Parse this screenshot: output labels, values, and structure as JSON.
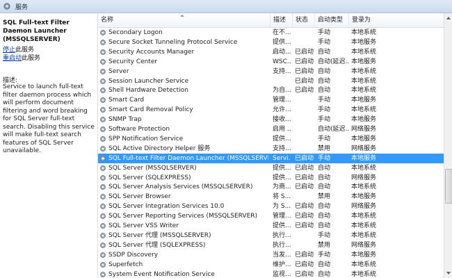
{
  "window": {
    "title": "服务"
  },
  "left": {
    "service_name": "SQL Full-text Filter Daemon Launcher (MSSQLSERVER)",
    "stop_link": "停止",
    "stop_suffix": "此服务",
    "restart_link": "重启动",
    "restart_suffix": "此服务",
    "desc_heading": "描述:",
    "description": "Service to launch full-text filter daemon process which will perform document filtering and word breaking for SQL Server full-text search. Disabling this service will make full-text search features of SQL Server unavailable."
  },
  "columns": [
    {
      "label": "名称"
    },
    {
      "label": "描述"
    },
    {
      "label": "状态"
    },
    {
      "label": "启动类型"
    },
    {
      "label": "登录为"
    }
  ],
  "rows": [
    {
      "name": "Secondary Logon",
      "desc": "在不...",
      "status": "",
      "start": "手动",
      "logon": "本地系统"
    },
    {
      "name": "Secure Socket Tunneling Protocol Service",
      "desc": "提供...",
      "status": "",
      "start": "手动",
      "logon": "本地服务"
    },
    {
      "name": "Security Accounts Manager",
      "desc": "启动...",
      "status": "已启动",
      "start": "自动",
      "logon": "本地系统"
    },
    {
      "name": "Security Center",
      "desc": "WSC...",
      "status": "已启动",
      "start": "自动(延迟...",
      "logon": "本地服务"
    },
    {
      "name": "Server",
      "desc": "支持...",
      "status": "已启动",
      "start": "自动",
      "logon": "本地系统"
    },
    {
      "name": "Session Launcher Service",
      "desc": "",
      "status": "已启动",
      "start": "自动",
      "logon": "本地系统"
    },
    {
      "name": "Shell Hardware Detection",
      "desc": "为自...",
      "status": "已启动",
      "start": "自动",
      "logon": "本地系统"
    },
    {
      "name": "Smart Card",
      "desc": "管理...",
      "status": "",
      "start": "手动",
      "logon": "本地服务"
    },
    {
      "name": "Smart Card Removal Policy",
      "desc": "允许...",
      "status": "",
      "start": "手动",
      "logon": "本地系统"
    },
    {
      "name": "SNMP Trap",
      "desc": "接收...",
      "status": "",
      "start": "手动",
      "logon": "本地服务"
    },
    {
      "name": "Software Protection",
      "desc": "启用 ...",
      "status": "",
      "start": "自动(延迟...",
      "logon": "网络服务"
    },
    {
      "name": "SPP Notification Service",
      "desc": "提供...",
      "status": "",
      "start": "手动",
      "logon": "本地服务"
    },
    {
      "name": "SQL Active Directory Helper 服务",
      "desc": "支持...",
      "status": "",
      "start": "禁用",
      "logon": "网络服务"
    },
    {
      "name": "SQL Full-text Filter Daemon Launcher (MSSQLSERVER)",
      "desc": "Servi...",
      "status": "已启动",
      "start": "手动",
      "logon": "本地服务",
      "selected": true
    },
    {
      "name": "SQL Server (MSSQLSERVER)",
      "desc": "提供...",
      "status": "已启动",
      "start": "自动",
      "logon": "本地系统"
    },
    {
      "name": "SQL Server (SQLEXPRESS)",
      "desc": "提供...",
      "status": "已启动",
      "start": "自动",
      "logon": "网络服务"
    },
    {
      "name": "SQL Server Analysis Services (MSSQLSERVER)",
      "desc": "为商...",
      "status": "已启动",
      "start": "自动",
      "logon": "本地系统"
    },
    {
      "name": "SQL Server Browser",
      "desc": "将 S...",
      "status": "",
      "start": "禁用",
      "logon": "本地服务"
    },
    {
      "name": "SQL Server Integration Services 10.0",
      "desc": "为 S...",
      "status": "已启动",
      "start": "自动",
      "logon": "网络服务"
    },
    {
      "name": "SQL Server Reporting Services (MSSQLSERVER)",
      "desc": "管理...",
      "status": "已启动",
      "start": "自动",
      "logon": "本地系统"
    },
    {
      "name": "SQL Server VSS Writer",
      "desc": "提供...",
      "status": "已启动",
      "start": "自动",
      "logon": "本地系统"
    },
    {
      "name": "SQL Server 代理 (MSSQLSERVER)",
      "desc": "执行...",
      "status": "",
      "start": "手动",
      "logon": "本地系统"
    },
    {
      "name": "SQL Server 代理 (SQLEXPRESS)",
      "desc": "执行...",
      "status": "",
      "start": "禁用",
      "logon": "网络服务"
    },
    {
      "name": "SSDP Discovery",
      "desc": "当发...",
      "status": "已启动",
      "start": "手动",
      "logon": "本地服务"
    },
    {
      "name": "Superfetch",
      "desc": "维护...",
      "status": "已启动",
      "start": "自动",
      "logon": "本地系统"
    },
    {
      "name": "System Event Notification Service",
      "desc": "监视...",
      "status": "已启动",
      "start": "自动",
      "logon": "本地系统"
    }
  ]
}
